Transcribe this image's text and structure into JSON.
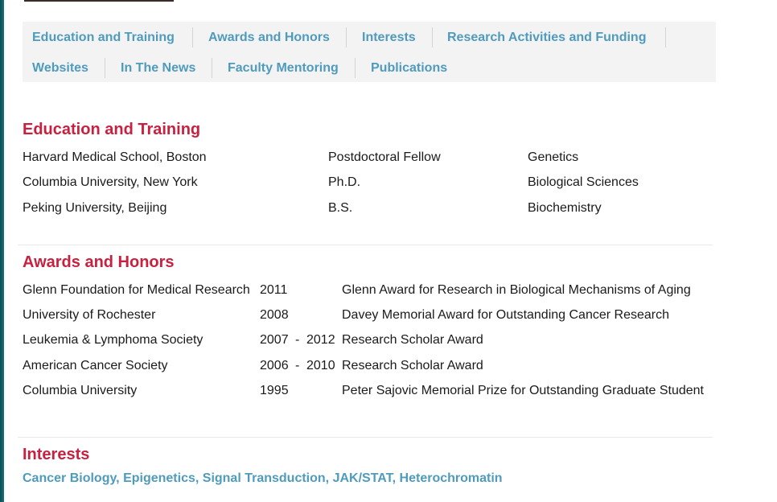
{
  "tabs": [
    "Education and Training",
    "Awards and Honors",
    "Interests",
    "Research Activities and Funding",
    "Websites",
    "In The News",
    "Faculty Mentoring",
    "Publications"
  ],
  "education": {
    "heading": "Education and Training",
    "rows": [
      {
        "institution": "Harvard Medical School, Boston",
        "degree": "Postdoctoral Fellow",
        "field": "Genetics"
      },
      {
        "institution": "Columbia University, New York",
        "degree": "Ph.D.",
        "field": "Biological Sciences"
      },
      {
        "institution": "Peking University, Beijing",
        "degree": "B.S.",
        "field": "Biochemistry"
      }
    ]
  },
  "awards": {
    "heading": "Awards and Honors",
    "rows": [
      {
        "organization": "Glenn Foundation for Medical Research",
        "start": "2011",
        "dash": "",
        "end": "",
        "award": "Glenn Award for Research in Biological Mechanisms of Aging"
      },
      {
        "organization": "University of Rochester",
        "start": "2008",
        "dash": "",
        "end": "",
        "award": "Davey Memorial Award for Outstanding Cancer Research"
      },
      {
        "organization": "Leukemia & Lymphoma Society",
        "start": "2007",
        "dash": "-",
        "end": "2012",
        "award": "Research Scholar Award"
      },
      {
        "organization": "American Cancer Society",
        "start": "2006",
        "dash": "-",
        "end": "2010",
        "award": "Research Scholar Award"
      },
      {
        "organization": "Columbia University",
        "start": "1995",
        "dash": "",
        "end": "",
        "award": "Peter Sajovic Memorial Prize for Outstanding Graduate Student"
      }
    ]
  },
  "interests": {
    "heading": "Interests",
    "items": [
      "Cancer Biology",
      "Epigenetics",
      "Signal Transduction",
      "JAK/STAT",
      "Heterochromatin"
    ],
    "separator": ", "
  },
  "colors": {
    "heading": "#c8213f",
    "link": "#4f9bbd",
    "nav_background": "#f3f3f3"
  }
}
